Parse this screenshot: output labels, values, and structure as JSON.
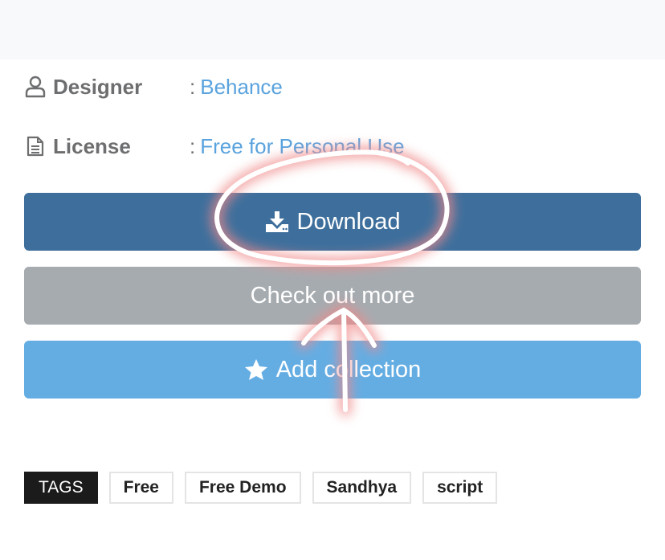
{
  "details": {
    "designer_label": "Designer",
    "designer_colon": ":",
    "designer_value": "Behance",
    "license_label": "License",
    "license_colon": ":",
    "license_value": "Free for Personal Use"
  },
  "actions": {
    "download_label": "Download",
    "check_more_label": "Check out more",
    "add_collection_label": "Add collection"
  },
  "tags": {
    "title": "TAGS",
    "items": [
      "Free",
      "Free Demo",
      "Sandhya",
      "script"
    ]
  },
  "icons": {
    "designer": "user-icon",
    "license": "document-icon",
    "download": "download-icon",
    "collection": "star-icon"
  },
  "colors": {
    "download": "#3e6f9c",
    "check_more": "#a6abb0",
    "add_collection": "#64ade3",
    "link": "#5aa3de",
    "annotation": "#f08a8a"
  }
}
